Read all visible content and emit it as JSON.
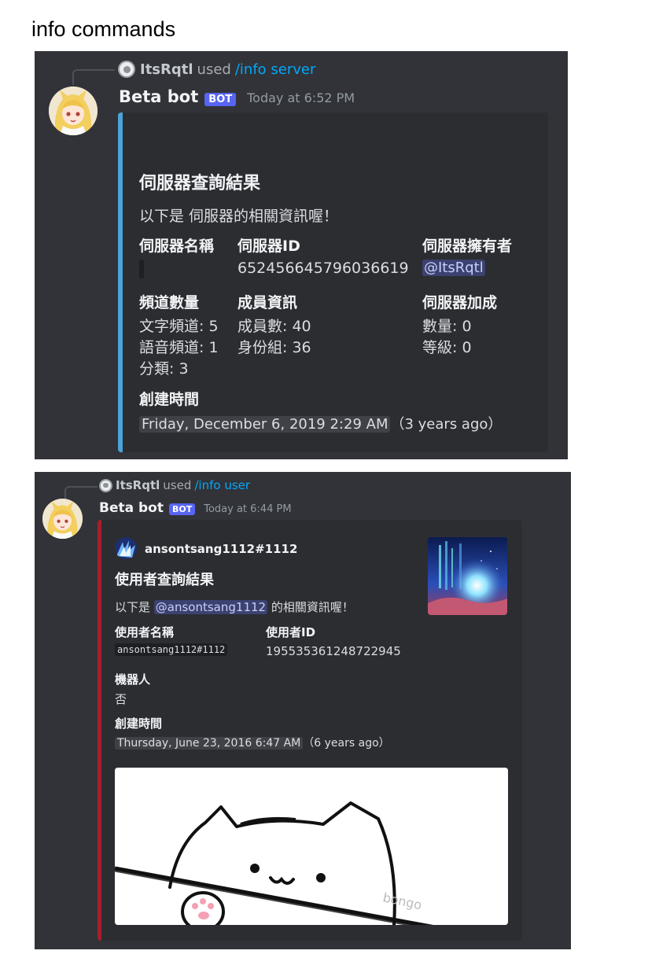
{
  "page_heading": "info commands",
  "server_card": {
    "reply": {
      "user": "ItsRqtl",
      "used": "used",
      "command": "/info server"
    },
    "author": {
      "name": "Beta bot",
      "tag": "BOT",
      "timestamp": "Today at 6:52 PM"
    },
    "embed": {
      "accent_color": "#4aa4d8",
      "title": "伺服器查詢結果",
      "description": "以下是  伺服器的相關資訊喔！",
      "fields": {
        "server_name": {
          "name": "伺服器名稱",
          "value": ""
        },
        "server_id": {
          "name": "伺服器ID",
          "value": "652456645796036619"
        },
        "server_owner": {
          "name": "伺服器擁有者",
          "value": "@ItsRqtl"
        },
        "channels": {
          "name": "頻道數量",
          "lines": [
            "文字頻道: 5",
            "語音頻道: 1",
            "分類: 3"
          ]
        },
        "members": {
          "name": "成員資訊",
          "lines": [
            "成員數: 40",
            "身份組: 36"
          ]
        },
        "boost": {
          "name": "伺服器加成",
          "lines": [
            "數量: 0",
            "等級: 0"
          ]
        },
        "created": {
          "name": "創建時間",
          "date": "Friday, December 6, 2019 2:29 AM",
          "relative": "（3 years ago）"
        }
      }
    }
  },
  "user_card": {
    "reply": {
      "user": "ItsRqtl",
      "used": "used",
      "command": "/info user"
    },
    "author": {
      "name": "Beta bot",
      "tag": "BOT",
      "timestamp": "Today at 6:44 PM"
    },
    "embed": {
      "accent_color": "#a3202a",
      "embed_author": "ansontsang1112#1112",
      "title": "使用者查詢結果",
      "description_prefix": "以下是 ",
      "description_mention": "@ansontsang1112",
      "description_suffix": " 的相關資訊喔！",
      "fields": {
        "username": {
          "name": "使用者名稱",
          "value": "ansontsang1112#1112"
        },
        "user_id": {
          "name": "使用者ID",
          "value": "195535361248722945"
        },
        "bot": {
          "name": "機器人",
          "value": "否"
        },
        "created": {
          "name": "創建時間",
          "date": "Thursday, June 23, 2016 6:47 AM",
          "relative": "（6 years ago）"
        }
      }
    }
  }
}
